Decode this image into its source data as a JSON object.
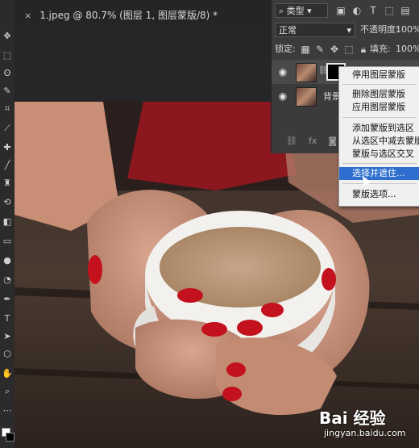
{
  "tab": {
    "close_glyph": "×",
    "title": "1.jpeg @ 80.7% (图层 1, 图层蒙版/8) *"
  },
  "layers_panel": {
    "filter_label": "类型",
    "blend_mode": "正常",
    "opacity_label": "不透明度:",
    "opacity_value": "100%",
    "lock_label": "锁定:",
    "fill_label": "填充:",
    "fill_value": "100%",
    "background_layer_name": "背景"
  },
  "context_menu": {
    "items": [
      "停用图层蒙版",
      "删除图层蒙版",
      "应用图层蒙版",
      "添加蒙版到选区",
      "从选区中减去蒙版",
      "蒙版与选区交叉",
      "选择并遮住...",
      "蒙版选项..."
    ],
    "highlighted_index": 6
  },
  "watermark": {
    "brand": "Bai 经验",
    "url": "jingyan.baidu.com"
  },
  "icons": [
    "move-icon",
    "marquee-icon",
    "lasso-icon",
    "quick-select-icon",
    "crop-icon",
    "eyedropper-icon",
    "healing-icon",
    "brush-icon",
    "stamp-icon",
    "history-brush-icon",
    "eraser-icon",
    "gradient-icon",
    "blur-icon",
    "dodge-icon",
    "pen-icon",
    "type-icon",
    "path-select-icon",
    "shape-icon",
    "hand-icon",
    "zoom-icon"
  ],
  "colors": {
    "menu_highlight": "#2d6ecf",
    "panel_bg": "#3b3b3b",
    "toolbar_bg": "#2b2b2b"
  }
}
